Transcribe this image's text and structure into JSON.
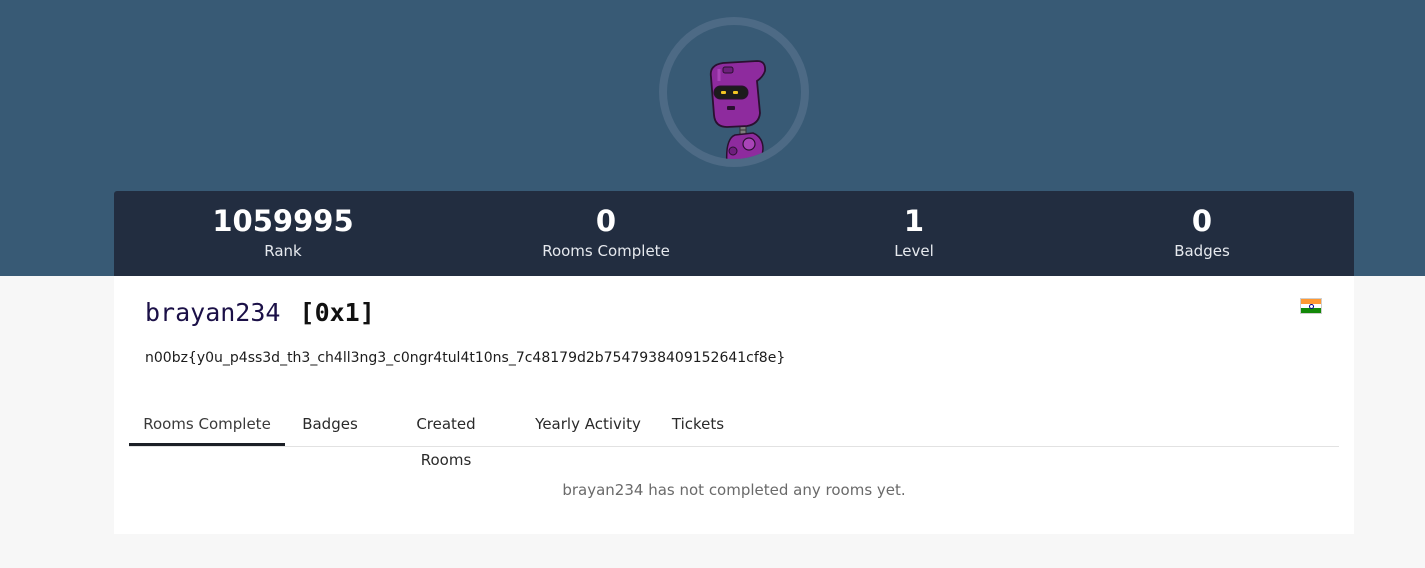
{
  "profile": {
    "username": "brayan234",
    "level_tag": "[0x1]",
    "bio": "n00bz{y0u_p4ss3d_th3_ch4ll3ng3_c0ngr4tul4t10ns_7c48179d2b7547938409152641cf8e}",
    "country_flag": "india-flag-icon"
  },
  "stats": [
    {
      "value": "1059995",
      "label": "Rank"
    },
    {
      "value": "0",
      "label": "Rooms Complete"
    },
    {
      "value": "1",
      "label": "Level"
    },
    {
      "value": "0",
      "label": "Badges"
    }
  ],
  "tabs": [
    {
      "label": "Rooms Complete",
      "active": true
    },
    {
      "label": "Badges",
      "active": false
    },
    {
      "label": "Created Rooms",
      "active": false
    },
    {
      "label": "Yearly Activity",
      "active": false
    },
    {
      "label": "Tickets",
      "active": false
    }
  ],
  "empty_message": "brayan234 has not completed any rooms yet.",
  "colors": {
    "hero_background": "#385a75",
    "stats_background": "#222d40",
    "avatar_robot": "#8e2b9e",
    "username": "#1b1047"
  }
}
